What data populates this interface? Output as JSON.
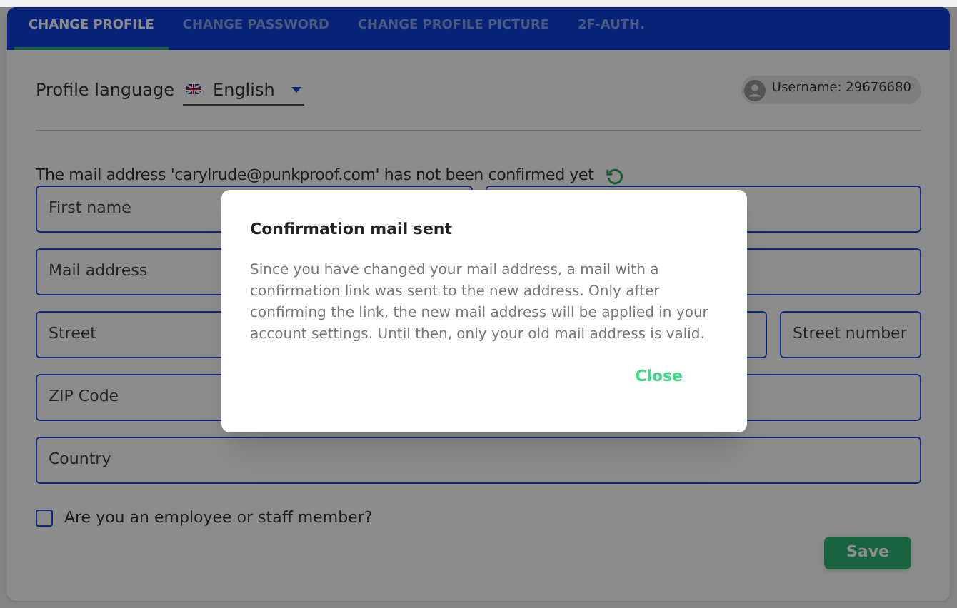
{
  "tabs": [
    {
      "label": "CHANGE PROFILE",
      "selected": true
    },
    {
      "label": "CHANGE PASSWORD",
      "selected": false
    },
    {
      "label": "CHANGE PROFILE PICTURE",
      "selected": false
    },
    {
      "label": "2F-AUTH.",
      "selected": false
    }
  ],
  "language": {
    "label": "Profile language",
    "value": "English"
  },
  "username": "Username: 29676680",
  "mail_notice": "The mail address 'carylrude@punkproof.com' has not been confirmed yet",
  "form_rows": [
    [
      {
        "kind": "half",
        "label": "First name"
      },
      {
        "kind": "half"
      }
    ],
    [
      {
        "kind": "half",
        "label": "Mail address"
      },
      {
        "kind": "half"
      }
    ],
    [
      {
        "kind": "wide",
        "label": "Street"
      },
      {
        "kind": "narrow",
        "label": "Street number"
      }
    ],
    [
      {
        "kind": "half",
        "label": "ZIP Code"
      },
      {
        "kind": "half"
      }
    ],
    [
      {
        "kind": "full",
        "label": "Country"
      }
    ]
  ],
  "employee_checkbox": {
    "label": "Are you an employee or staff member?",
    "checked": false
  },
  "save_button": "Save",
  "dialog": {
    "title": "Confirmation mail sent",
    "body": "Since you have changed your mail address, a mail with a confirmation link was sent to the new address. Only after confirming the link, the new mail address will be applied in your account settings. Until then, only your old mail address is valid.",
    "button": "Close"
  }
}
